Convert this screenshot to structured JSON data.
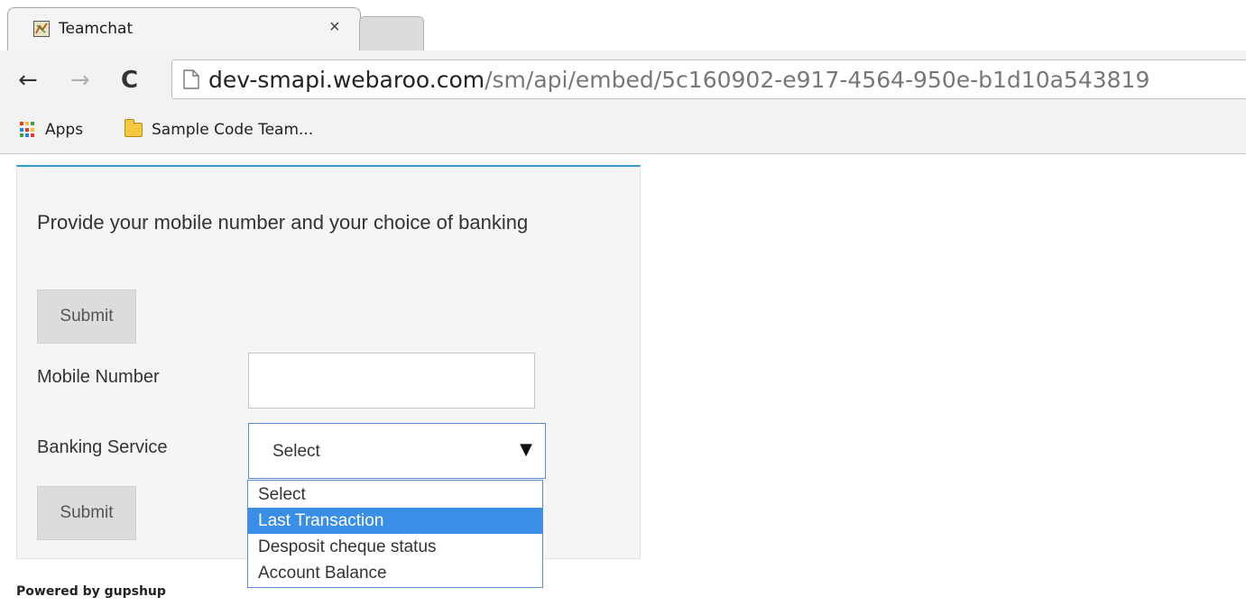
{
  "browser": {
    "tab": {
      "title": "Teamchat",
      "close_glyph": "×",
      "favicon": "teamchat-logo-icon"
    },
    "nav": {
      "back_glyph": "←",
      "forward_glyph": "→",
      "reload_glyph": "C"
    },
    "address": {
      "host": "dev-smapi.webaroo.com",
      "path": "/sm/api/embed/5c160902-e917-4564-950e-b1d10a543819"
    },
    "bookmarks": [
      {
        "label": "Apps",
        "icon": "apps-grid-icon"
      },
      {
        "label": "Sample Code Team...",
        "icon": "folder-icon"
      }
    ]
  },
  "form": {
    "accent_color": "#2e9bd6",
    "prompt": "Provide your mobile number and your choice of banking",
    "submit_top_label": "Submit",
    "mobile_label": "Mobile Number",
    "mobile_value": "",
    "service_label": "Banking Service",
    "service_selected": "Select",
    "service_arrow": "▼",
    "service_options": [
      "Select",
      "Last Transaction",
      "Desposit cheque status",
      "Account Balance"
    ],
    "service_highlighted_index": 1,
    "submit_bottom_label": "Submit"
  },
  "footer": {
    "powered_by": "Powered by gupshup"
  }
}
